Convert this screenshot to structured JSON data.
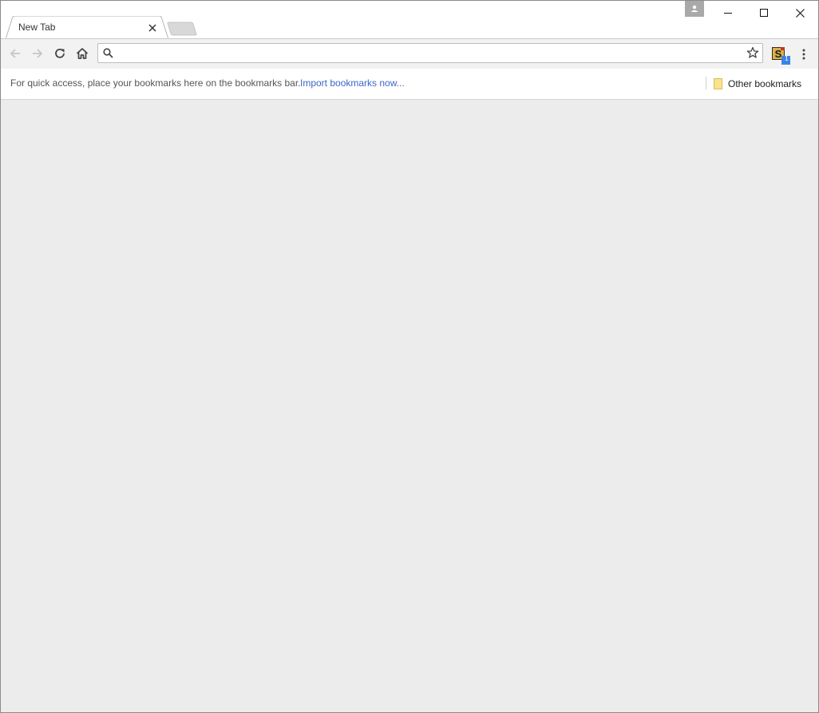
{
  "tab": {
    "title": "New Tab"
  },
  "toolbar": {
    "omnibox": {
      "value": "",
      "placeholder": ""
    },
    "extension_badge": "1"
  },
  "bookmarks_bar": {
    "hint": "For quick access, place your bookmarks here on the bookmarks bar.",
    "import_link": "Import bookmarks now...",
    "other_bookmarks": "Other bookmarks"
  },
  "icons": {
    "back": "arrow-left-icon",
    "forward": "arrow-right-icon",
    "reload": "reload-icon",
    "home": "home-icon",
    "search": "search-icon",
    "star": "star-icon",
    "menu": "vertical-dots-icon",
    "folder": "folder-icon",
    "profile": "person-icon"
  },
  "colors": {
    "link": "#3d66c8",
    "content_bg": "#ececec",
    "folder": "#fbe28d"
  }
}
